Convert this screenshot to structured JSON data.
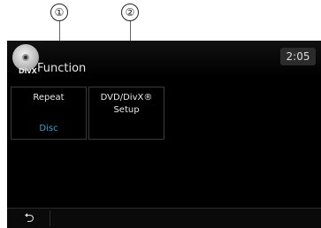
{
  "callouts": [
    "①",
    "②"
  ],
  "header": {
    "badge": "DivX",
    "title": "Function",
    "clock": "2:05"
  },
  "tiles": [
    {
      "label": "Repeat",
      "value": "Disc"
    },
    {
      "label_line1": "DVD/DivX®",
      "label_line2": "Setup"
    }
  ],
  "footer": {
    "back_glyph": "⮌"
  },
  "colors": {
    "value_accent": "#2aa7d6",
    "leader_line": "#d8324a"
  }
}
